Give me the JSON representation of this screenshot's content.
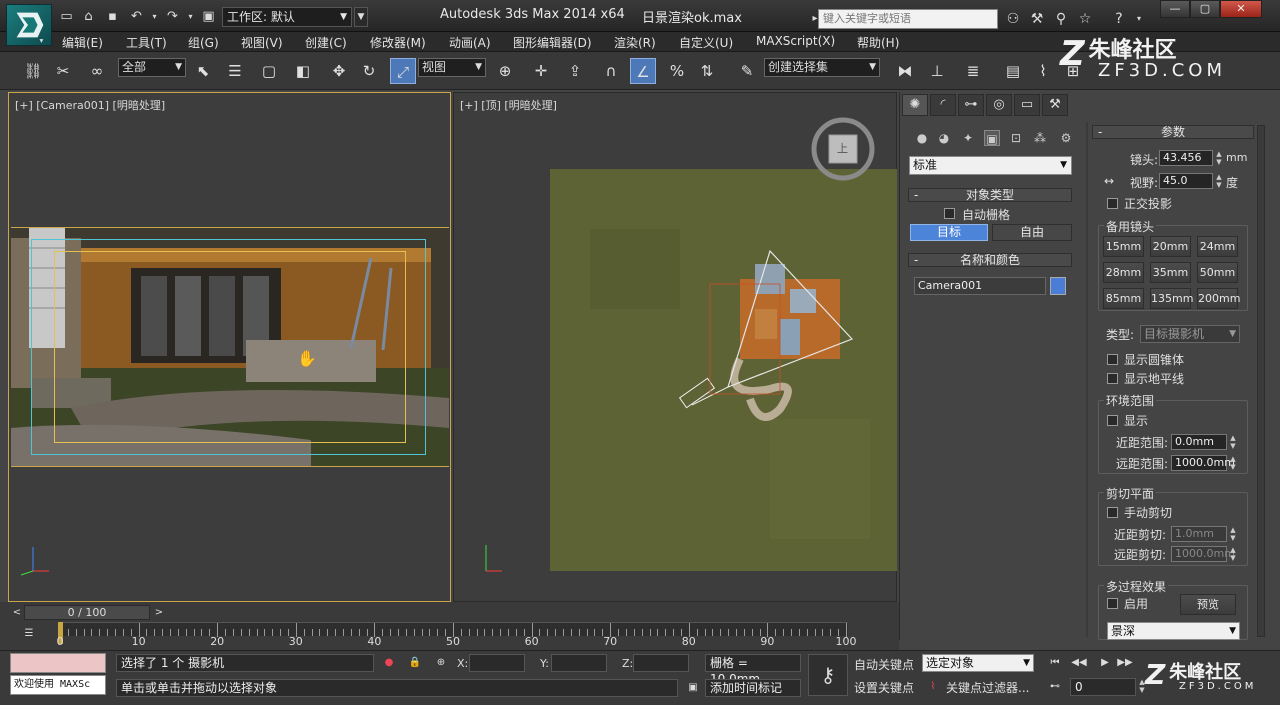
{
  "window": {
    "app_title": "Autodesk 3ds Max  2014 x64",
    "file_title": "日景渲染ok.max",
    "workspace_label": "工作区: 默认",
    "search_placeholder": "键入关键字或短语"
  },
  "menu": [
    "编辑(E)",
    "工具(T)",
    "组(G)",
    "视图(V)",
    "创建(C)",
    "修改器(M)",
    "动画(A)",
    "图形编辑器(D)",
    "渲染(R)",
    "自定义(U)",
    "MAXScript(X)",
    "帮助(H)"
  ],
  "toolbar": {
    "filter_value": "全部",
    "coord_value": "视图",
    "selection_set_value": "创建选择集"
  },
  "viewports": {
    "camera_label": "[+] [Camera001] [明暗处理]",
    "top_label": "[+] [顶] [明暗处理]",
    "viewcube_face": "上"
  },
  "command_panel": {
    "standard_dropdown": "标准",
    "object_type": {
      "title": "对象类型",
      "autogrid": "自动栅格",
      "btn_target": "目标",
      "btn_free": "自由"
    },
    "name_color": {
      "title": "名称和颜色",
      "name_value": "Camera001",
      "color": "#4a7ed6"
    },
    "params": {
      "title": "参数",
      "lens_label": "镜头:",
      "lens_value": "43.456",
      "lens_unit": "mm",
      "fov_label": "视野:",
      "fov_value": "45.0",
      "fov_unit": "度",
      "ortho": "正交投影",
      "stock_lenses_title": "备用镜头",
      "lenses": [
        "15mm",
        "20mm",
        "24mm",
        "28mm",
        "35mm",
        "50mm",
        "85mm",
        "135mm",
        "200mm"
      ],
      "type_label": "类型:",
      "type_value": "目标摄影机",
      "show_cone": "显示圆锥体",
      "show_horizon": "显示地平线",
      "env_title": "环境范围",
      "env_show": "显示",
      "near_range_label": "近距范围:",
      "near_range_value": "0.0mm",
      "far_range_label": "远距范围:",
      "far_range_value": "1000.0mm",
      "clip_title": "剪切平面",
      "clip_manual": "手动剪切",
      "near_clip_label": "近距剪切:",
      "near_clip_value": "1.0mm",
      "far_clip_label": "远距剪切:",
      "far_clip_value": "1000.0mm",
      "multipass_title": "多过程效果",
      "multipass_enable": "启用",
      "preview_btn": "预览",
      "effect_value": "景深"
    }
  },
  "timeline": {
    "frame_readout": "0 / 100",
    "ticks": [
      "0",
      "10",
      "20",
      "30",
      "40",
      "50",
      "60",
      "70",
      "80",
      "90",
      "100"
    ],
    "current_frame": 0,
    "total_frames": 100
  },
  "status": {
    "maxscript_label": "欢迎使用 MAXSc",
    "selected_msg": "选择了 1 个 摄影机",
    "prompt_msg": "单击或单击并拖动以选择对象",
    "x_label": "X:",
    "y_label": "Y:",
    "z_label": "Z:",
    "grid_label": "栅格 = 10.0mm",
    "add_time_tag": "添加时间标记",
    "auto_key": "自动关键点",
    "set_key": "设置关键点",
    "selected_obj": "选定对象",
    "key_filters": "关键点过滤器...",
    "frame_value": "0"
  },
  "watermark": {
    "brand": "朱峰社区",
    "site": "ZF3D.COM"
  }
}
